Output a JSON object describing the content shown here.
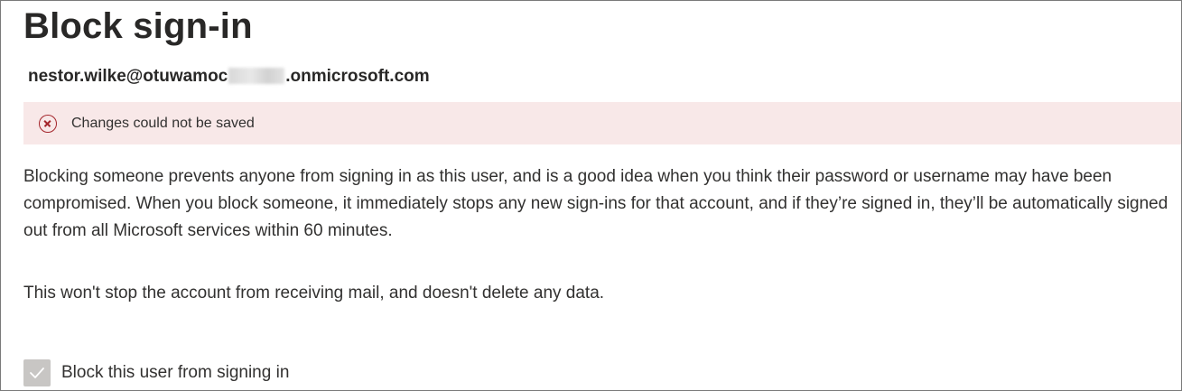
{
  "panel": {
    "title": "Block sign-in",
    "user_email_prefix": "nestor.wilke@otuwamoc",
    "user_email_suffix": ".onmicrosoft.com"
  },
  "error_bar": {
    "message": "Changes could not be saved",
    "icon": "error-circle-icon",
    "background_color": "#f8e8e8",
    "icon_color": "#a4262c"
  },
  "description": "Blocking someone prevents anyone from signing in as this user, and is a good idea when you think their password or username may have been compromised. When you block someone, it immediately stops any new sign-ins for that account, and if they’re signed in, they’ll be automatically signed out from all Microsoft services within 60 minutes.",
  "note": "This won't stop the account from receiving mail, and doesn't delete any data.",
  "block_checkbox": {
    "label": "Block this user from signing in",
    "checked": true,
    "disabled": true
  }
}
